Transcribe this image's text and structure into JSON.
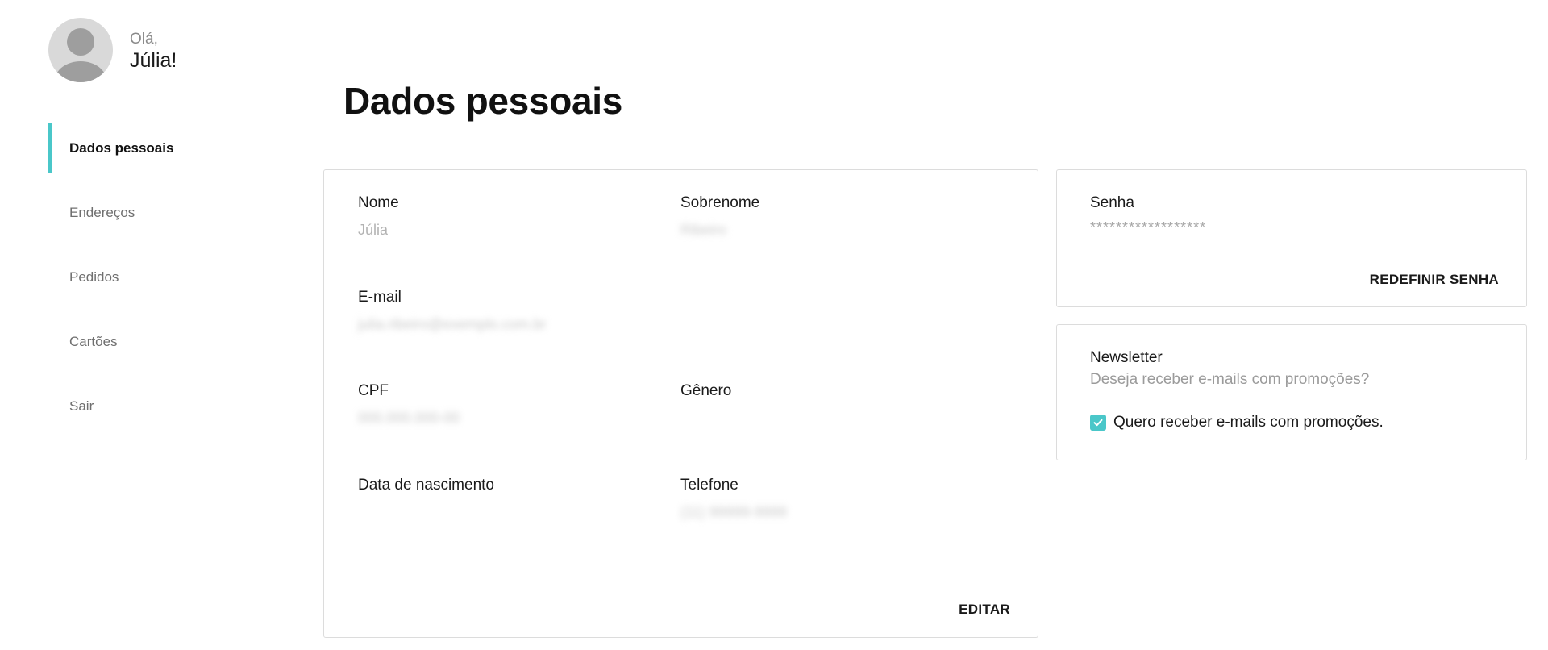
{
  "profile": {
    "greeting": "Olá,",
    "name": "Júlia!",
    "avatar_icon": "user-avatar-icon"
  },
  "sidebar": {
    "items": [
      {
        "label": "Dados pessoais",
        "active": true
      },
      {
        "label": "Endereços",
        "active": false
      },
      {
        "label": "Pedidos",
        "active": false
      },
      {
        "label": "Cartões",
        "active": false
      },
      {
        "label": "Sair",
        "active": false
      }
    ]
  },
  "main": {
    "title": "Dados pessoais",
    "personal": {
      "fields": {
        "first_name": {
          "label": "Nome",
          "value": "Júlia"
        },
        "last_name": {
          "label": "Sobrenome",
          "value": "Ribeiro"
        },
        "email": {
          "label": "E-mail",
          "value": "julia.ribeiro@exemplo.com.br"
        },
        "cpf": {
          "label": "CPF",
          "value": "000.000.000-00"
        },
        "gender": {
          "label": "Gênero",
          "value": ""
        },
        "birth_date": {
          "label": "Data de nascimento",
          "value": ""
        },
        "phone": {
          "label": "Telefone",
          "value": "(11) 99999-9999"
        }
      },
      "edit_label": "EDITAR"
    },
    "password": {
      "label": "Senha",
      "value": "******************",
      "reset_label": "REDEFINIR SENHA"
    },
    "newsletter": {
      "title": "Newsletter",
      "subtitle": "Deseja receber e-mails com promoções?",
      "checkbox_label": "Quero receber e-mails com promoções.",
      "checked": true
    }
  },
  "colors": {
    "accent": "#4ac7c9",
    "muted_text": "#9b9b9b",
    "border": "#dcdcdc"
  }
}
